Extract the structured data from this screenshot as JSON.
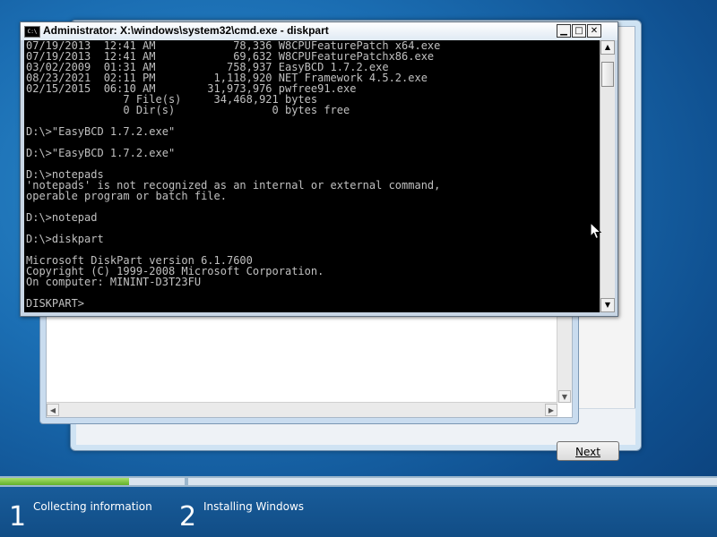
{
  "cmd": {
    "title": "Administrator: X:\\windows\\system32\\cmd.exe - diskpart",
    "icon": "cmd-icon",
    "console_lines": [
      "07/19/2013  12:41 AM            78,336 W8CPUFeaturePatch x64.exe",
      "07/19/2013  12:41 AM            69,632 W8CPUFeaturePatchx86.exe",
      "03/02/2009  01:31 AM           758,937 EasyBCD 1.7.2.exe",
      "08/23/2021  02:11 PM         1,118,920 NET Framework 4.5.2.exe",
      "02/15/2015  06:10 AM        31,973,976 pwfree91.exe",
      "               7 File(s)     34,468,921 bytes",
      "               0 Dir(s)               0 bytes free",
      "",
      "D:\\>\"EasyBCD 1.7.2.exe\"",
      "",
      "D:\\>\"EasyBCD 1.7.2.exe\"",
      "",
      "D:\\>notepads",
      "'notepads' is not recognized as an internal or external command,",
      "operable program or batch file.",
      "",
      "D:\\>notepad",
      "",
      "D:\\>diskpart",
      "",
      "Microsoft DiskPart version 6.1.7600",
      "Copyright (C) 1999-2008 Microsoft Corporation.",
      "On computer: MININT-D3T23FU",
      "",
      "DISKPART> "
    ],
    "buttons": {
      "minimize": "▁",
      "maximize": "□",
      "close": "✕"
    }
  },
  "setup": {
    "next_label": "Next"
  },
  "progress": {
    "steps": [
      {
        "number": "1",
        "label": "Collecting information"
      },
      {
        "number": "2",
        "label": "Installing Windows"
      }
    ],
    "step1_fill_fraction": 0.7
  },
  "colors": {
    "console_bg": "#000000",
    "console_text": "#c0c0c0",
    "progress_green": "#63b02a",
    "desktop_blue": "#1b6eb3"
  }
}
